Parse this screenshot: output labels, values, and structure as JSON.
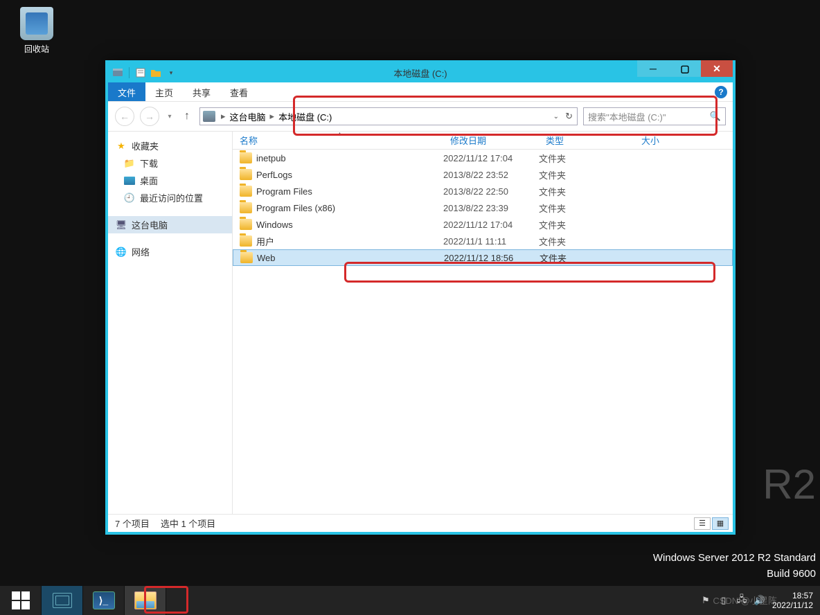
{
  "desktop": {
    "recycle_bin_label": "回收站"
  },
  "watermark": {
    "line1": "Windows Server 2012 R2 Standard",
    "line2": "Build 9600",
    "bg": "R2"
  },
  "csdn_watermark": "CSDN @小星陈",
  "window": {
    "title": "本地磁盘 (C:)",
    "tabs": {
      "file": "文件",
      "home": "主页",
      "share": "共享",
      "view": "查看"
    },
    "breadcrumb": {
      "root": "这台电脑",
      "drive": "本地磁盘 (C:)"
    },
    "search_placeholder": "搜索\"本地磁盘 (C:)\"",
    "columns": {
      "name": "名称",
      "date": "修改日期",
      "type": "类型",
      "size": "大小"
    },
    "rows": [
      {
        "name": "inetpub",
        "date": "2022/11/12 17:04",
        "type": "文件夹",
        "selected": false
      },
      {
        "name": "PerfLogs",
        "date": "2013/8/22 23:52",
        "type": "文件夹",
        "selected": false
      },
      {
        "name": "Program Files",
        "date": "2013/8/22 22:50",
        "type": "文件夹",
        "selected": false
      },
      {
        "name": "Program Files (x86)",
        "date": "2013/8/22 23:39",
        "type": "文件夹",
        "selected": false
      },
      {
        "name": "Windows",
        "date": "2022/11/12 17:04",
        "type": "文件夹",
        "selected": false
      },
      {
        "name": "用户",
        "date": "2022/11/1 11:11",
        "type": "文件夹",
        "selected": false
      },
      {
        "name": "Web",
        "date": "2022/11/12 18:56",
        "type": "文件夹",
        "selected": true
      }
    ],
    "nav": {
      "favorites": "收藏夹",
      "downloads": "下载",
      "desktop": "桌面",
      "recent": "最近访问的位置",
      "this_pc": "这台电脑",
      "network": "网络"
    },
    "status": {
      "count": "7 个项目",
      "selection": "选中 1 个项目"
    }
  },
  "taskbar": {
    "clock_time": "18:57",
    "clock_date": "2022/11/12"
  }
}
